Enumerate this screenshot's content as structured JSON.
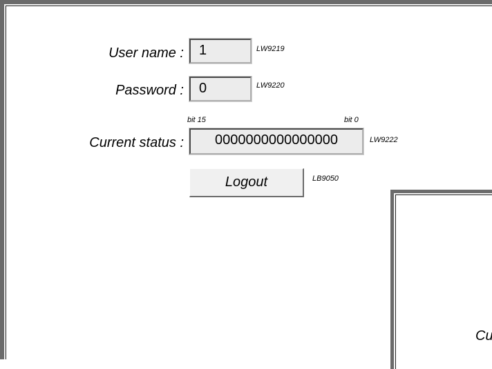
{
  "form": {
    "username_label": "User name :",
    "username_value": "1",
    "username_tag": "LW9219",
    "password_label": "Password :",
    "password_value": "0",
    "password_tag": "LW9220",
    "bit_high": "bit 15",
    "bit_low": "bit 0",
    "status_label": "Current status :",
    "status_value": "0000000000000000",
    "status_tag": "LW9222",
    "logout_label": "Logout",
    "logout_tag": "LB9050"
  },
  "side_panel": {
    "partial_text": "Cu"
  }
}
